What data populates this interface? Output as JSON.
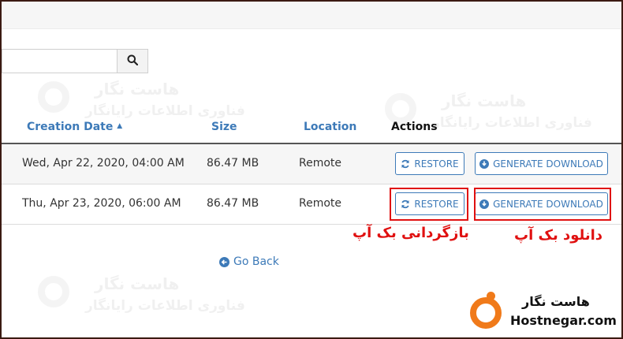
{
  "search": {
    "value": "",
    "placeholder": ""
  },
  "columns": {
    "creation_date": "Creation Date",
    "size": "Size",
    "location": "Location",
    "actions": "Actions"
  },
  "sort_indicator": "▲",
  "rows": [
    {
      "date": "Wed, Apr 22, 2020, 04:00 AM",
      "size": "86.47 MB",
      "location": "Remote"
    },
    {
      "date": "Thu, Apr 23, 2020, 06:00 AM",
      "size": "86.47 MB",
      "location": "Remote"
    }
  ],
  "buttons": {
    "restore": "RESTORE",
    "generate_download": "GENERATE DOWNLOAD"
  },
  "annotations": {
    "restore": "بازگردانی بک آپ",
    "download": "دانلود بک آپ"
  },
  "go_back": "Go Back",
  "watermark": {
    "title": "هاست نگار",
    "subtitle": "فناوری اطلاعات رایانگار"
  },
  "brand": {
    "name_fa": "هاست نگار",
    "name_en": "Hostnegar.com",
    "accent": "#f07a1a"
  },
  "colors": {
    "link": "#3d7ab8",
    "highlight": "#e01010"
  },
  "icons": [
    "search-icon",
    "refresh-icon",
    "download-circle-icon",
    "arrow-left-circle-icon",
    "sort-up-icon"
  ]
}
